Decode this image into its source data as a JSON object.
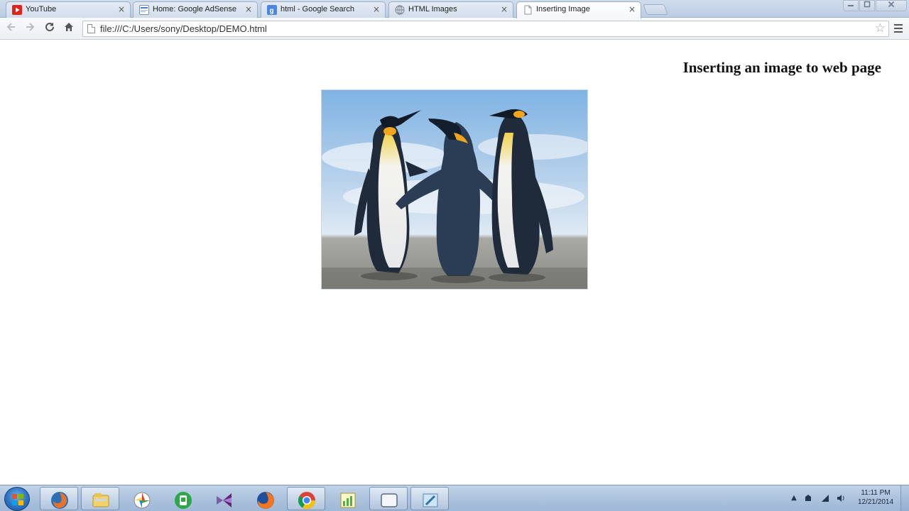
{
  "browser": {
    "tabs": [
      {
        "label": "YouTube",
        "icon": "youtube-icon",
        "active": false
      },
      {
        "label": "Home: Google AdSense",
        "icon": "adsense-icon",
        "active": false
      },
      {
        "label": "html - Google Search",
        "icon": "google-search-icon",
        "active": false
      },
      {
        "label": "HTML Images",
        "icon": "globe-icon",
        "active": false
      },
      {
        "label": "Inserting Image",
        "icon": "page-icon",
        "active": true
      }
    ],
    "tab_close_glyph": "×",
    "address_bar": {
      "url": "file:///C:/Users/sony/Desktop/DEMO.html"
    }
  },
  "page": {
    "heading": "Inserting an image to web page",
    "image": {
      "subject": "penguins",
      "icon": "penguins-image"
    }
  },
  "taskbar": {
    "pinned": [
      {
        "name": "firefox-alt-icon",
        "open": true
      },
      {
        "name": "file-explorer-icon",
        "open": true
      },
      {
        "name": "picasa-icon",
        "open": false
      },
      {
        "name": "green-app-icon",
        "open": false
      },
      {
        "name": "visual-studio-icon",
        "open": false
      },
      {
        "name": "firefox-icon",
        "open": false
      },
      {
        "name": "chrome-icon",
        "open": true
      },
      {
        "name": "chart-app-icon",
        "open": false
      },
      {
        "name": "window-app-icon",
        "open": true
      },
      {
        "name": "paint-app-icon",
        "open": true
      }
    ],
    "clock": {
      "time": "11:11 PM",
      "date": "12/21/2014"
    }
  },
  "colors": {
    "tabstrip": "#c6d5e8",
    "taskbar": "#aec4de",
    "heading": "#111111"
  }
}
